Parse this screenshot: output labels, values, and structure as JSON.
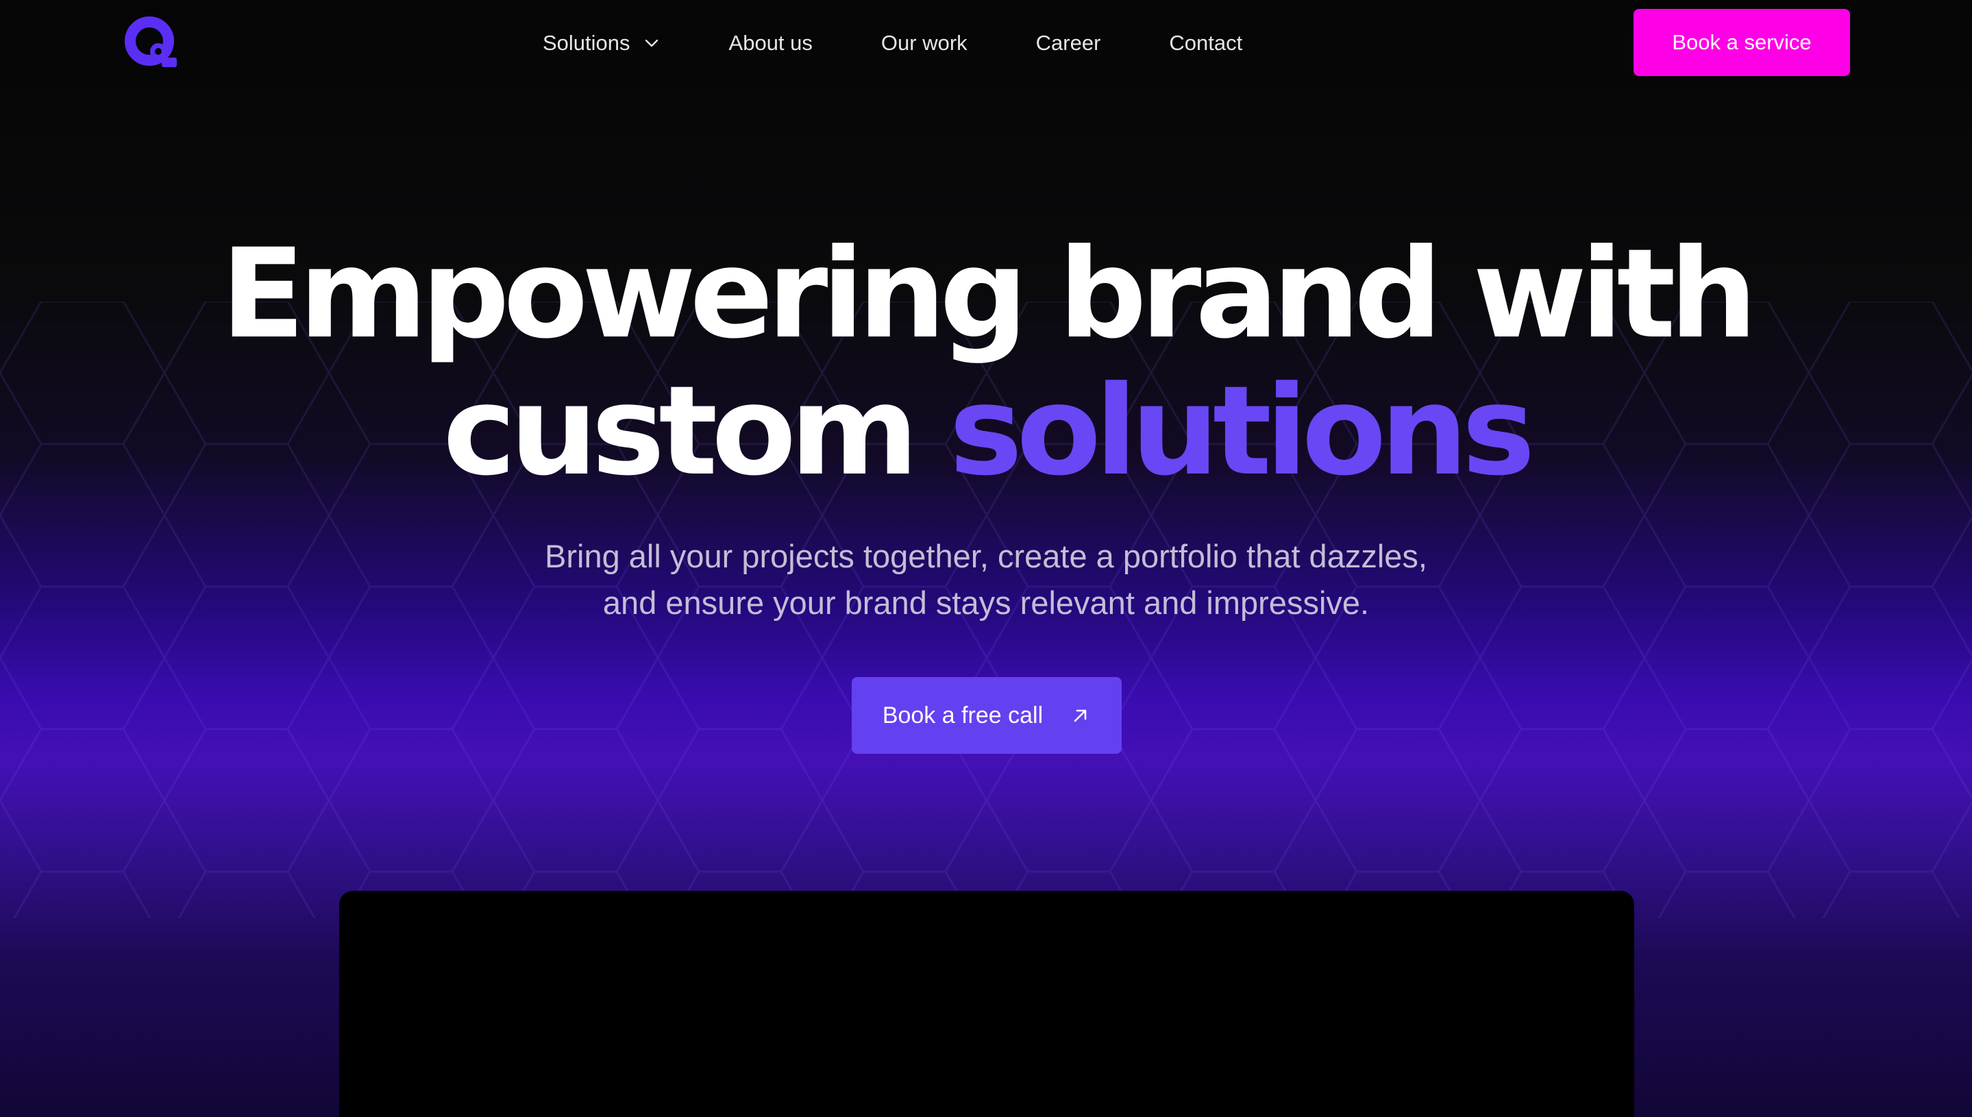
{
  "nav": {
    "logo_icon": "q-logo-icon",
    "links": [
      {
        "label": "Solutions",
        "has_dropdown": true
      },
      {
        "label": "About us"
      },
      {
        "label": "Our work"
      },
      {
        "label": "Career"
      },
      {
        "label": "Contact"
      }
    ],
    "book_service_label": "Book a service"
  },
  "hero": {
    "headline_line1": "Empowering brand with",
    "headline_line2_plain": "custom",
    "headline_line2_accent": "solutions",
    "subtitle_line1": "Bring all your projects together, create a portfolio that dazzles,",
    "subtitle_line2": "and ensure your brand stays relevant and impressive.",
    "cta_label": "Book a free call",
    "cta_icon": "arrow-up-right-icon"
  },
  "colors": {
    "background": "#050505",
    "accent_purple": "#6a47f5",
    "cta_purple": "#6441f0",
    "book_service_magenta": "#ff00e6",
    "glow_purple": "#4410b6"
  }
}
